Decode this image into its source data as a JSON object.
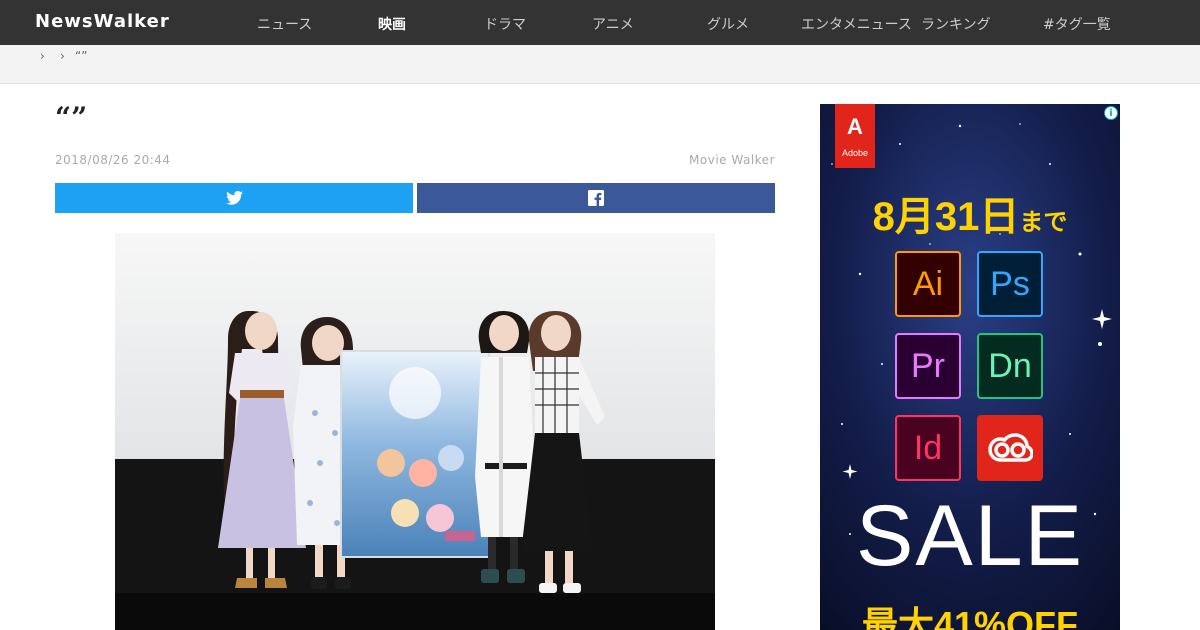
{
  "nav": {
    "logo": "NewsWalker",
    "items": [
      {
        "label": "ニュース",
        "active": false
      },
      {
        "label": "映画",
        "active": true
      },
      {
        "label": "ドラマ",
        "active": false
      },
      {
        "label": "アニメ",
        "active": false
      },
      {
        "label": "グルメ",
        "active": false
      },
      {
        "label": "エンタメニュース",
        "active": false
      },
      {
        "label": "ランキング",
        "active": false
      },
      {
        "label": "#タグ一覧",
        "active": false
      }
    ]
  },
  "breadcrumb": {
    "separator": "›",
    "current": "“”"
  },
  "article": {
    "title": "“”",
    "date": "2018/08/26 20:44",
    "source": "Movie Walker",
    "share": {
      "twitter_color": "#1da1f2",
      "facebook_color": "#3b5998"
    }
  },
  "ad": {
    "info_icon": "i",
    "brand": {
      "mark": "A",
      "word": "Adobe"
    },
    "date_big": "8月31日",
    "date_small": "まで",
    "apps": [
      {
        "label": "Ai",
        "bg": "#330000",
        "fg": "#ff9a00",
        "border": "#ff9a00"
      },
      {
        "label": "Ps",
        "bg": "#001e36",
        "fg": "#31a8ff",
        "border": "#31a8ff"
      },
      {
        "label": "Pr",
        "bg": "#2a0033",
        "fg": "#e77bff",
        "border": "#e77bff"
      },
      {
        "label": "Dn",
        "bg": "#032b1f",
        "fg": "#6ef2b6",
        "border": "#26c281"
      },
      {
        "label": "Id",
        "bg": "#49021f",
        "fg": "#ff3366",
        "border": "#ff3366"
      },
      {
        "label": "",
        "bg": "#e1251b",
        "fg": "#ffffff",
        "border": "#e1251b",
        "icon": "creative-cloud-icon"
      }
    ],
    "sale": "SALE",
    "off": "最大41%OFF"
  }
}
